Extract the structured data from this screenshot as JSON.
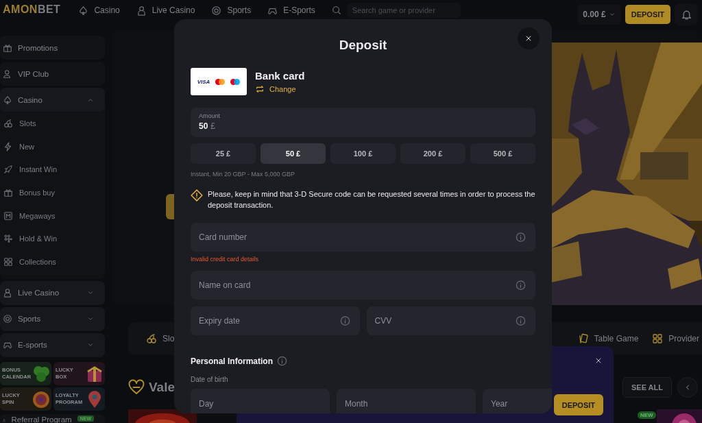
{
  "header": {
    "logo": {
      "part_1": "AMON",
      "part_2": "BET"
    },
    "nav": [
      {
        "label": "Casino"
      },
      {
        "label": "Live Casino"
      },
      {
        "label": "Sports"
      },
      {
        "label": "E-Sports"
      }
    ],
    "search": {
      "placeholder": "Search game or provider"
    },
    "balance": "0.00 £",
    "deposit_button": "DEPOSIT"
  },
  "sidebar": {
    "items": [
      {
        "kind": "link",
        "label": "Promotions"
      },
      {
        "kind": "link",
        "label": "VIP Club"
      },
      {
        "kind": "group",
        "label": "Casino",
        "expanded": true,
        "children": [
          {
            "label": "Slots"
          },
          {
            "label": "New"
          },
          {
            "label": "Instant Win"
          },
          {
            "label": "Bonus buy"
          },
          {
            "label": "Megaways"
          },
          {
            "label": "Hold & Win"
          },
          {
            "label": "Collections"
          }
        ]
      },
      {
        "kind": "group",
        "label": "Live Casino",
        "expanded": false
      },
      {
        "kind": "group",
        "label": "Sports",
        "expanded": false
      },
      {
        "kind": "group",
        "label": "E-sports",
        "expanded": false
      }
    ],
    "promo_tiles": [
      {
        "label": "BONUS CALENDAR"
      },
      {
        "label": "LUCKY BOX"
      },
      {
        "label": "LUCKY SPIN"
      },
      {
        "label": "LOYALTY PROGRAM"
      }
    ],
    "referral": {
      "label": "Referral Program",
      "badge": "NEW"
    }
  },
  "main": {
    "categories": [
      {
        "label": "Slo"
      },
      {
        "label": "Table Game"
      },
      {
        "label": "Provider"
      }
    ],
    "section": {
      "title": "Vale",
      "see_all": "SEE ALL"
    },
    "promo_popup": {
      "button": "DEPOSIT"
    },
    "new_badge": "NEW"
  },
  "deposit_dialog": {
    "title": "Deposit",
    "method": {
      "logo_text": "VISA",
      "name": "Bank card",
      "change": "Change"
    },
    "amount": {
      "label": "Amount",
      "value": "50",
      "currency": "£"
    },
    "presets": [
      {
        "label": "25 £",
        "selected": false
      },
      {
        "label": "50 £",
        "selected": true
      },
      {
        "label": "100 £",
        "selected": false
      },
      {
        "label": "200 £",
        "selected": false
      },
      {
        "label": "500 £",
        "selected": false
      }
    ],
    "limits": "Instant, Min 20 GBP - Max 5,000 GBP",
    "notice": "Please, keep in mind that 3-D Secure code can be requested several times in order to process the deposit transaction.",
    "card_number": {
      "placeholder": "Card number",
      "error": "Invalid credit card details"
    },
    "name_on_card": {
      "placeholder": "Name on card"
    },
    "expiry": {
      "placeholder": "Expiry date"
    },
    "cvv": {
      "placeholder": "CVV"
    },
    "personal": {
      "title": "Personal Information",
      "dob_label": "Date of birth",
      "day": {
        "placeholder": "Day"
      },
      "month": {
        "placeholder": "Month"
      },
      "year": {
        "placeholder": "Year"
      }
    }
  }
}
